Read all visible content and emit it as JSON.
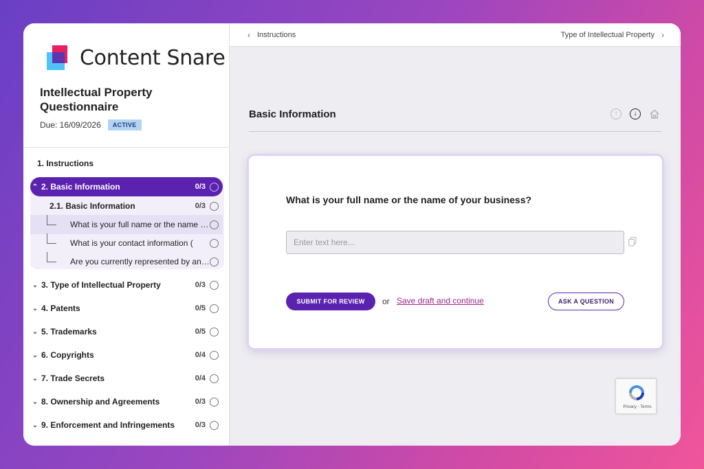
{
  "brand": {
    "name": "Content Snare"
  },
  "questionnaire": {
    "title": "Intellectual Property Questionnaire",
    "due": "Due: 16/09/2026",
    "status": "ACTIVE"
  },
  "nav": {
    "instructions": "1. Instructions",
    "active_section": {
      "label": "2. Basic Information",
      "count": "0/3"
    },
    "subsection": {
      "label": "2.1. Basic Information",
      "count": "0/3"
    },
    "questions": [
      "What is your full name or the name of your business?",
      "What is your contact information (",
      "Are you currently represented by an attorney"
    ],
    "sections": [
      {
        "label": "3. Type of Intellectual Property",
        "count": "0/3"
      },
      {
        "label": "4. Patents",
        "count": "0/5"
      },
      {
        "label": "5. Trademarks",
        "count": "0/5"
      },
      {
        "label": "6. Copyrights",
        "count": "0/4"
      },
      {
        "label": "7. Trade Secrets",
        "count": "0/4"
      },
      {
        "label": "8. Ownership and Agreements",
        "count": "0/3"
      },
      {
        "label": "9. Enforcement and Infringements",
        "count": "0/3"
      }
    ]
  },
  "topbar": {
    "prev": "Instructions",
    "next": "Type of Intellectual Property"
  },
  "section": {
    "title": "Basic Information"
  },
  "card": {
    "question": "What is your full name or the name of your business?",
    "input_value": "",
    "input_placeholder": "Enter text here...",
    "submit_label": "SUBMIT FOR REVIEW",
    "or_label": "or",
    "draft_label": "Save draft and continue",
    "ask_label": "ASK A QUESTION"
  },
  "recaptcha": {
    "text": "Privacy - Terms"
  },
  "colors": {
    "accent": "#5b22b0",
    "link": "#a01f8c",
    "badge": "#b3d4f5"
  }
}
